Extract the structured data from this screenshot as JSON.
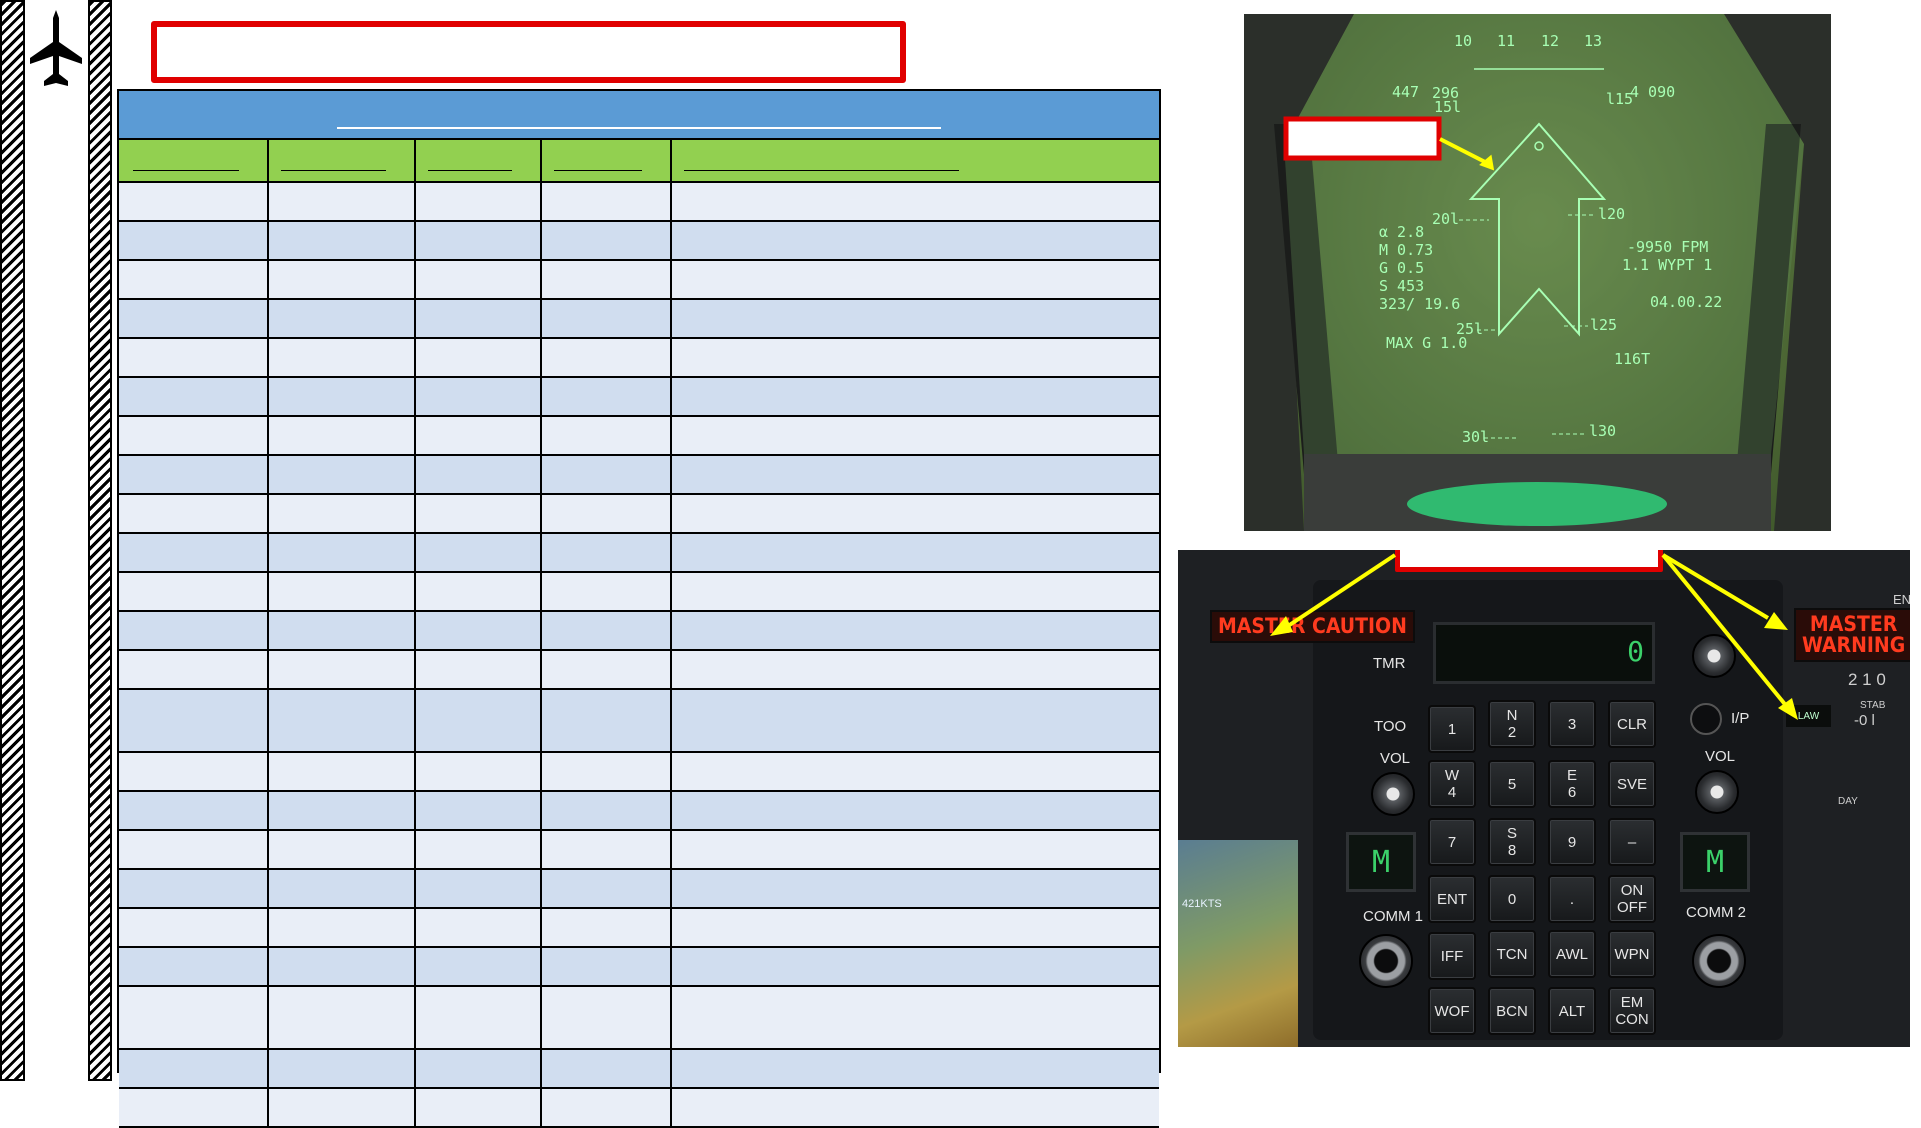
{
  "sidebar": {
    "icon": "aircraft-silhouette-icon"
  },
  "table": {
    "header_color": "#5b9bd5",
    "subheader_color": "#92d050",
    "row_colors": [
      "#e9eef7",
      "#d0ddef"
    ],
    "columns": 5,
    "rows": 23
  },
  "hud": {
    "heading_ticks": [
      "10",
      "11",
      "12",
      "13"
    ],
    "airspeed": "447",
    "altitude": "4 090",
    "heading_bug": "296",
    "pitch_left_1": "15l",
    "pitch_right_1": "l15",
    "pitch_left_2": "20l",
    "pitch_right_2": "l20",
    "pitch_left_3": "25l",
    "pitch_right_3": "l25",
    "pitch_left_4": "30l",
    "pitch_right_4": "l30",
    "aoa": "α 2.8",
    "mach": "M 0.73",
    "g": "G 0.5",
    "s": "S 453",
    "range": "323/ 19.6",
    "max_g": "MAX G 1.0",
    "vvi": "-9950 FPM",
    "waypoint": "1.1 WYPT 1",
    "timer": "04.00.22",
    "tacan": "116T"
  },
  "panel": {
    "master_caution": "MASTER\nCAUTION",
    "master_warning": "MASTER\nWARNING",
    "timer_label": "TMR",
    "display_value": "0",
    "too": "TOO",
    "vol_left": "VOL",
    "vol_right": "VOL",
    "ip": "I/P",
    "law": "LAW",
    "comm1": "COMM 1",
    "comm2": "COMM 2",
    "comm_disp": "M",
    "keys": {
      "k1": "1",
      "k2": "N\n2",
      "k3": "3",
      "clr": "CLR",
      "k4": "W\n4",
      "k5": "5",
      "k6": "E\n6",
      "sve": "SVE",
      "k7": "7",
      "k8": "S\n8",
      "k9": "9",
      "dash": "–",
      "ent": "ENT",
      "k0": "0",
      "dot": ".",
      "onoff": "ON\nOFF",
      "iff": "IFF",
      "tcn": "TCN",
      "awl": "AWL",
      "wpn": "WPN",
      "wof": "WOF",
      "bcn": "BCN",
      "alt": "ALT",
      "emcon": "EM\nCON"
    },
    "right_side": {
      "stab_label": "STAB",
      "stab_value": "‑0 l",
      "top_value": "2 1 0",
      "day": "DAY",
      "en": "EN"
    },
    "left_map": {
      "speed": "421KTS"
    }
  }
}
